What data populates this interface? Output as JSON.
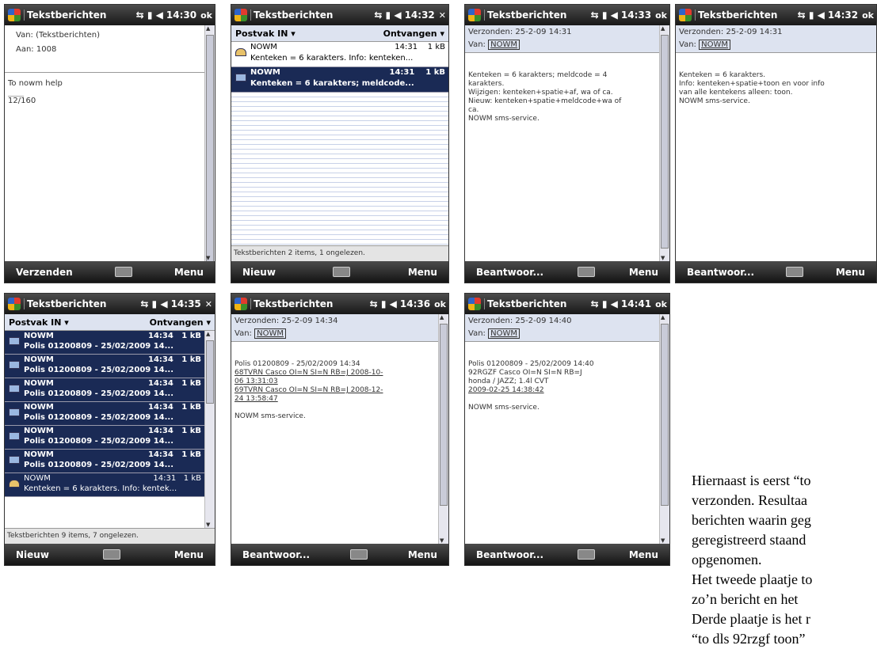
{
  "screens": {
    "s1": {
      "title": "Tekstberichten",
      "time": "14:30",
      "corner": "ok",
      "from_label": "Van: (Tekstberichten)",
      "to_label": "Aan: 1008",
      "text": "To nowm help",
      "counter": "12/160",
      "soft_left": "Verzenden",
      "soft_right": "Menu"
    },
    "s2": {
      "title": "Tekstberichten",
      "time": "14:32",
      "corner": "✕",
      "folder": "Postvak IN ▾",
      "sort": "Ontvangen ▾",
      "messages": [
        {
          "sender": "NOWM",
          "time": "14:31",
          "size": "1 kB",
          "preview": "Kenteken = 6 karakters. Info: kenteken..."
        },
        {
          "sender": "NOWM",
          "time": "14:31",
          "size": "1 kB",
          "preview": "Kenteken = 6 karakters; meldcode..."
        }
      ],
      "status": "Tekstberichten  2 items, 1 ongelezen.",
      "soft_left": "Nieuw",
      "soft_right": "Menu"
    },
    "s3": {
      "title": "Tekstberichten",
      "time": "14:33",
      "corner": "ok",
      "sent": "Verzonden: 25-2-09 14:31",
      "van_label": "Van:",
      "van": "NOWM",
      "body": [
        "Kenteken = 6 karakters; meldcode = 4",
        "karakters.",
        "Wijzigen: kenteken+spatie+af, wa of ca.",
        "Nieuw: kenteken+spatie+meldcode+wa of",
        "ca.",
        "NOWM sms-service."
      ],
      "soft_left": "Beantwoor...",
      "soft_right": "Menu"
    },
    "s4": {
      "title": "Tekstberichten",
      "time": "14:32",
      "corner": "ok",
      "sent": "Verzonden: 25-2-09 14:31",
      "van_label": "Van:",
      "van": "NOWM",
      "body": [
        "Kenteken = 6 karakters.",
        "Info: kenteken+spatie+toon en voor info",
        "van alle kentekens alleen: toon.",
        "NOWM sms-service."
      ],
      "soft_left": "Beantwoor...",
      "soft_right": "Menu"
    },
    "s5": {
      "title": "Tekstberichten",
      "time": "14:35",
      "corner": "✕",
      "folder": "Postvak IN ▾",
      "sort": "Ontvangen ▾",
      "messages": [
        {
          "sender": "NOWM",
          "time": "14:34",
          "size": "1 kB",
          "preview": "Polis 01200809 - 25/02/2009 14..."
        },
        {
          "sender": "NOWM",
          "time": "14:34",
          "size": "1 kB",
          "preview": "Polis 01200809 - 25/02/2009 14..."
        },
        {
          "sender": "NOWM",
          "time": "14:34",
          "size": "1 kB",
          "preview": "Polis 01200809 - 25/02/2009 14..."
        },
        {
          "sender": "NOWM",
          "time": "14:34",
          "size": "1 kB",
          "preview": "Polis 01200809 - 25/02/2009 14..."
        },
        {
          "sender": "NOWM",
          "time": "14:34",
          "size": "1 kB",
          "preview": "Polis 01200809 - 25/02/2009 14..."
        },
        {
          "sender": "NOWM",
          "time": "14:34",
          "size": "1 kB",
          "preview": "Polis 01200809 - 25/02/2009 14..."
        },
        {
          "sender": "NOWM",
          "time": "14:31",
          "size": "1 kB",
          "preview": "Kenteken = 6 karakters. Info: kentek..."
        }
      ],
      "status": "Tekstberichten  9 items, 7 ongelezen.",
      "soft_left": "Nieuw",
      "soft_right": "Menu"
    },
    "s6": {
      "title": "Tekstberichten",
      "time": "14:36",
      "corner": "ok",
      "sent": "Verzonden: 25-2-09 14:34",
      "van_label": "Van:",
      "van": "NOWM",
      "body": [
        "Polis 01200809 - 25/02/2009 14:34",
        "68TVRN Casco OI=N SI=N RB=J 2008-10-",
        "06 13:31:03",
        "69TVRN Casco OI=N SI=N RB=J 2008-12-",
        "24 13:58:47",
        "",
        "NOWM sms-service."
      ],
      "soft_left": "Beantwoor...",
      "soft_right": "Menu"
    },
    "s7": {
      "title": "Tekstberichten",
      "time": "14:41",
      "corner": "ok",
      "sent": "Verzonden: 25-2-09 14:40",
      "van_label": "Van:",
      "van": "NOWM",
      "body": [
        "Polis 01200809 - 25/02/2009 14:40",
        "92RGZF Casco OI=N SI=N RB=J",
        "honda / JAZZ; 1.4l CVT",
        "2009-02-25 14:38:42",
        "",
        "NOWM sms-service."
      ],
      "soft_left": "Beantwoor...",
      "soft_right": "Menu"
    }
  },
  "caption": [
    "Hiernaast is eerst “to",
    "verzonden. Resultaa",
    "berichten waarin geg",
    "geregistreerd staand",
    "opgenomen.",
    "Het tweede plaatje to",
    "zo’n bericht en het",
    "Derde plaatje is het r",
    "“to dls 92rzgf toon”"
  ]
}
